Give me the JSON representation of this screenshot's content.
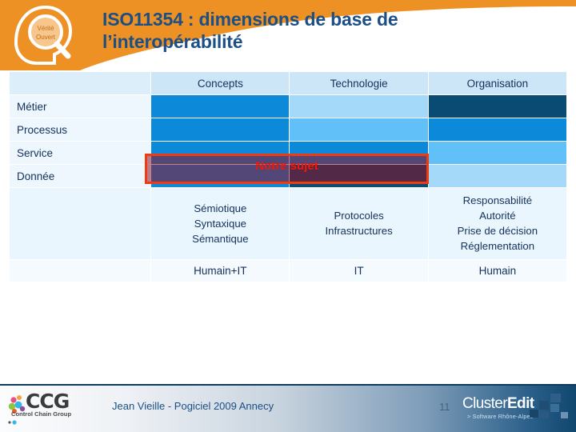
{
  "slide": {
    "title_line1": "ISO11354 : dimensions de base de",
    "title_line2": "l’interopérabilité",
    "title_color": "#1b4f86",
    "banner_color": "#ed9124"
  },
  "logo": {
    "name": "magnifier-badge-logo",
    "inner_line1": "Vérité",
    "inner_line2": "Ouvert"
  },
  "table": {
    "corner_label": "",
    "columns": [
      "Concepts",
      "Technologie",
      "Organisation"
    ],
    "rows": [
      {
        "label": "Métier",
        "cells": [
          {
            "column": "Concepts",
            "color": "#0c8ad9",
            "level": "mid"
          },
          {
            "column": "Technologie",
            "color": "#a5d9fa",
            "level": "pale"
          },
          {
            "column": "Organisation",
            "color": "#0a4b73",
            "level": "navy"
          }
        ]
      },
      {
        "label": "Processus",
        "cells": [
          {
            "column": "Concepts",
            "color": "#0c8ad9",
            "level": "mid"
          },
          {
            "column": "Technologie",
            "color": "#62c0f8",
            "level": "lt"
          },
          {
            "column": "Organisation",
            "color": "#0c8ad9",
            "level": "mid"
          }
        ]
      },
      {
        "label": "Service",
        "cells": [
          {
            "column": "Concepts",
            "color": "#0c8ad9",
            "level": "mid"
          },
          {
            "column": "Technologie",
            "color": "#0c8ad9",
            "level": "mid"
          },
          {
            "column": "Organisation",
            "color": "#62c0f8",
            "level": "lt"
          }
        ]
      },
      {
        "label": "Donnée",
        "cells": [
          {
            "column": "Concepts",
            "color": "#0c8ad9",
            "level": "mid"
          },
          {
            "column": "Technologie",
            "color": "#0a4b73",
            "level": "navy"
          },
          {
            "column": "Organisation",
            "color": "#a5d9fa",
            "level": "pale"
          }
        ]
      }
    ],
    "detail_row": {
      "label": "",
      "concepts": "Sémiotique\nSyntaxique\nSémantique",
      "technologie": "Protocoles\nInfrastructures",
      "organisation": "Responsabilité\nAutorité\nPrise de décision\nRéglementation"
    },
    "summary_row": {
      "label": "",
      "concepts": "Humain+IT",
      "technologie": "IT",
      "organisation": "Humain"
    }
  },
  "highlight": {
    "label": "Notre sujet",
    "border_color": "#f03a10",
    "text_color": "#f01a0a",
    "fill_color": "rgba(150,10,30,0.52)"
  },
  "footer": {
    "ccg_wordmark": "CCG",
    "ccg_tagline": "Control Chain Group",
    "center_text": "Jean Vieille - Pogiciel 2009 Annecy",
    "page_number": "11",
    "cluster_word_light": "Cluster",
    "cluster_word_bold": "Edit",
    "cluster_tagline": "> Software Rhône-Alpes"
  }
}
